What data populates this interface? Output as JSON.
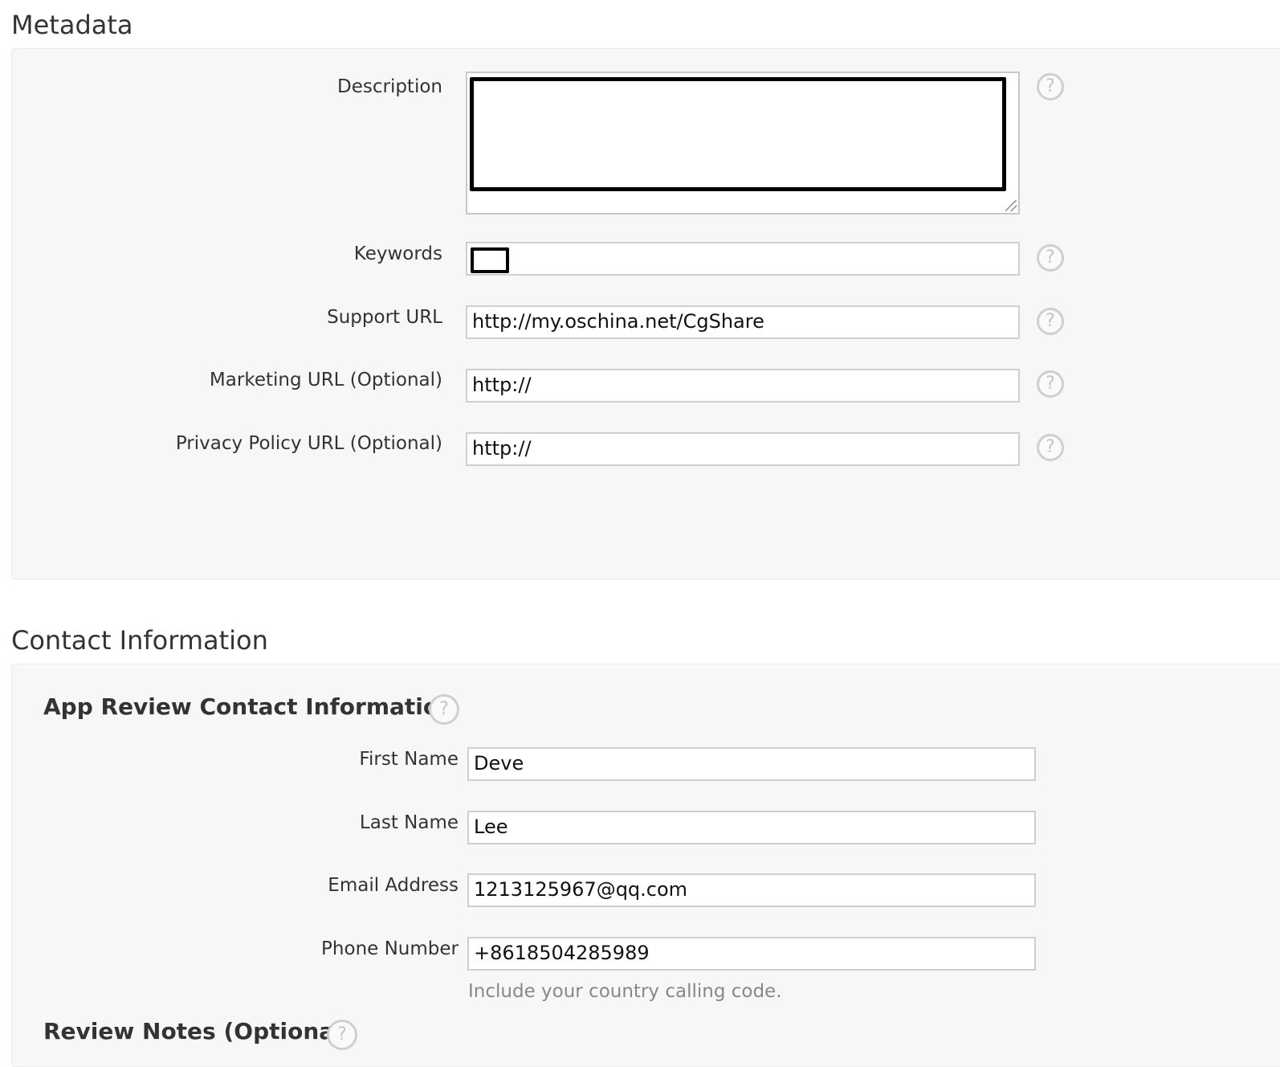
{
  "metadata": {
    "title": "Metadata",
    "description": {
      "label": "Description",
      "value": ""
    },
    "keywords": {
      "label": "Keywords",
      "value": ""
    },
    "support_url": {
      "label": "Support URL",
      "value": "http://my.oschina.net/CgShare"
    },
    "marketing_url": {
      "label": "Marketing URL (Optional)",
      "value": "http://"
    },
    "privacy_url": {
      "label": "Privacy Policy URL (Optional)",
      "value": "http://"
    },
    "help_glyph": "?"
  },
  "contact": {
    "title": "Contact Information",
    "review_title": "App Review Contact Information",
    "first_name": {
      "label": "First Name",
      "value": "Deve"
    },
    "last_name": {
      "label": "Last Name",
      "value": "Lee"
    },
    "email": {
      "label": "Email Address",
      "value": "1213125967@qq.com"
    },
    "phone": {
      "label": "Phone Number",
      "value": "+8618504285989",
      "hint": "Include your country calling code."
    },
    "review_notes": {
      "label": "Review Notes (Optional)"
    }
  }
}
